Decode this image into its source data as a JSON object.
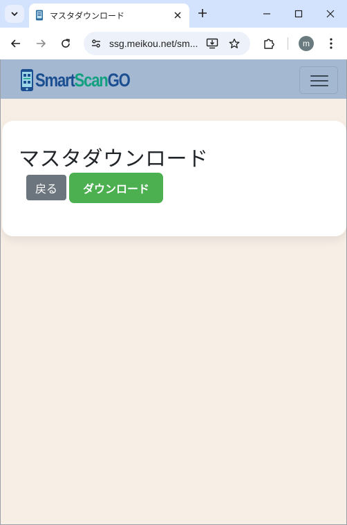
{
  "browser": {
    "tab_title": "マスタダウンロード",
    "url": "ssg.meikou.net/sm...",
    "profile_initial": "m",
    "icons": {
      "tab_list": "chevron-down-icon",
      "tab_favicon": "phone-icon",
      "tab_close": "close-icon",
      "new_tab": "plus-icon",
      "minimize": "minimize-icon",
      "maximize": "maximize-icon",
      "close_window": "close-icon",
      "back": "arrow-left-icon",
      "forward": "arrow-right-icon",
      "reload": "reload-icon",
      "site_info": "tune-icon",
      "install": "install-icon",
      "bookmark": "star-icon",
      "extensions": "puzzle-icon",
      "menu": "kebab-menu-icon"
    }
  },
  "navbar": {
    "brand_part1": "Smart",
    "brand_part2": "Scan",
    "brand_part3": "GO",
    "toggler_icon": "hamburger-icon",
    "background": "#a4b8d2"
  },
  "main": {
    "title": "マスタダウンロード",
    "back_label": "戻る",
    "download_label": "ダウンロード"
  },
  "colors": {
    "page_background": "#f7efe6",
    "back_button": "#6c757d",
    "download_button": "#4caf50",
    "brand_blue": "#1b4f91",
    "brand_green": "#12a07f"
  }
}
